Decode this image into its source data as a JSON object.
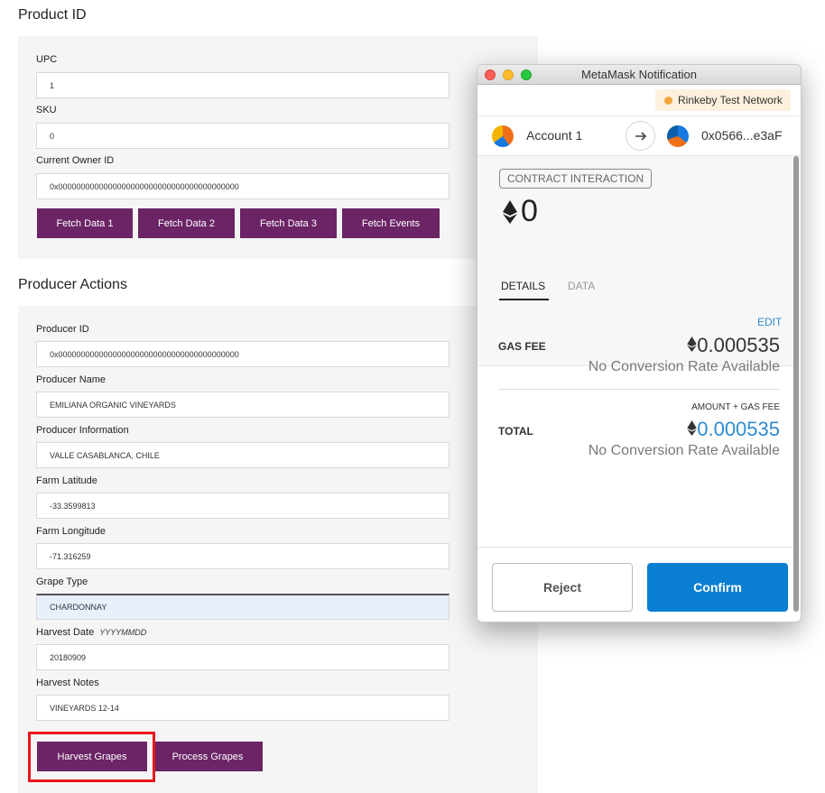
{
  "product_section": {
    "title": "Product ID",
    "fields": [
      {
        "label": "UPC",
        "value": "1"
      },
      {
        "label": "SKU",
        "value": "0"
      },
      {
        "label": "Current Owner ID",
        "value": "0x0000000000000000000000000000000000000000"
      }
    ],
    "buttons": [
      "Fetch Data 1",
      "Fetch Data 2",
      "Fetch Data 3",
      "Fetch Events"
    ]
  },
  "producer_section": {
    "title": "Producer Actions",
    "fields": [
      {
        "label": "Producer ID",
        "value": "0x0000000000000000000000000000000000000000"
      },
      {
        "label": "Producer Name",
        "value": "EMILIANA ORGANIC VINEYARDS"
      },
      {
        "label": "Producer Information",
        "value": "VALLE CASABLANCA, CHILE"
      },
      {
        "label": "Farm Latitude",
        "value": "-33.3599813"
      },
      {
        "label": "Farm Longitude",
        "value": "-71.316259"
      },
      {
        "label": "Grape Type",
        "value": "CHARDONNAY"
      },
      {
        "label": "Harvest Date",
        "hint": "YYYYMMDD",
        "value": "20180909"
      },
      {
        "label": "Harvest Notes",
        "value": "VINEYARDS 12-14"
      }
    ],
    "buttons": [
      "Harvest Grapes",
      "Process Grapes"
    ]
  },
  "metamask": {
    "window_title": "MetaMask Notification",
    "network": "Rinkeby Test Network",
    "from_account": "Account 1",
    "to_address": "0x0566...e3aF",
    "badge": "CONTRACT INTERACTION",
    "amount": "0",
    "tabs": [
      "DETAILS",
      "DATA"
    ],
    "edit": "EDIT",
    "gas_fee_label": "GAS FEE",
    "gas_fee_value": "0.000535",
    "no_conversion": "No Conversion Rate Available",
    "amount_gas_label": "AMOUNT + GAS FEE",
    "total_label": "TOTAL",
    "total_value": "0.000535",
    "reject": "Reject",
    "confirm": "Confirm",
    "colors": {
      "primary": "#0a7fd2",
      "link": "#2f8bd0",
      "action_button": "#6b2466",
      "highlight_box": "#e8181c"
    }
  }
}
